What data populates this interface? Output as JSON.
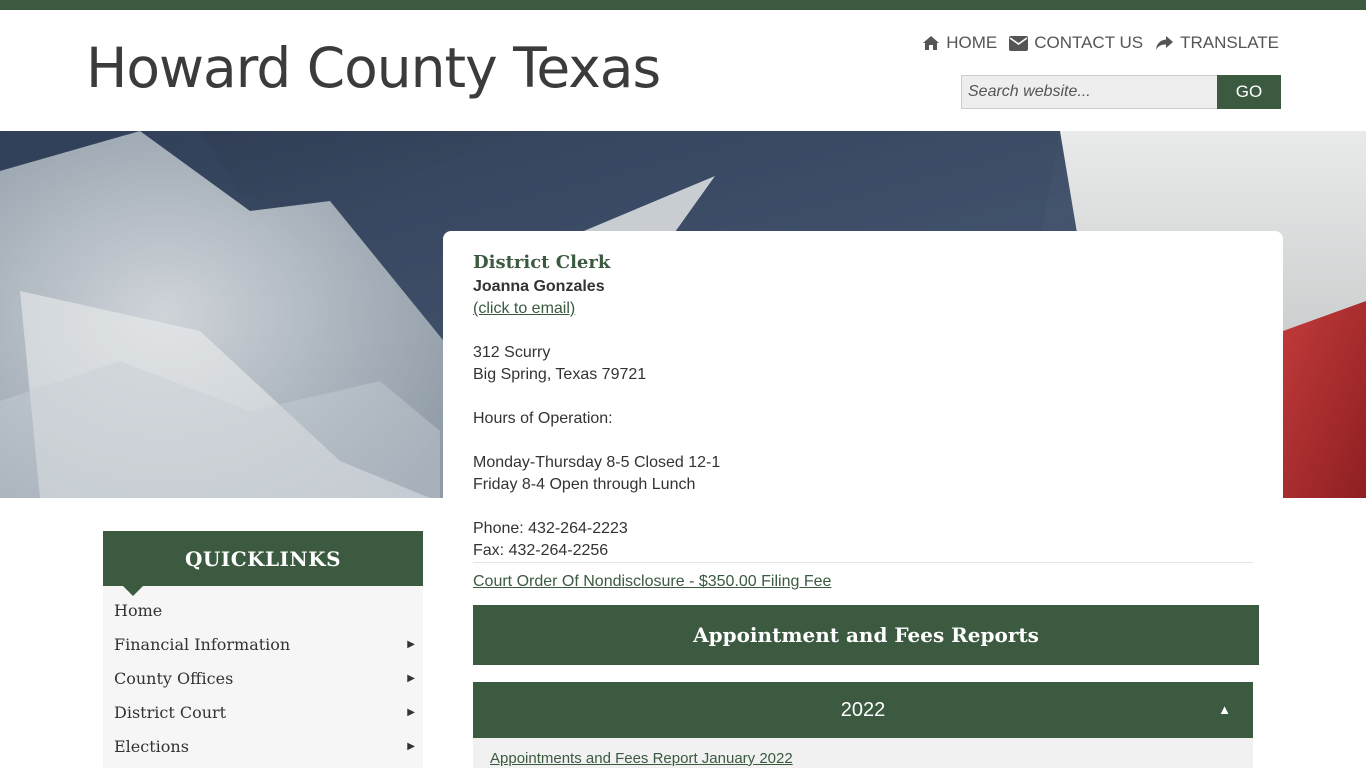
{
  "site": {
    "title": "Howard County Texas"
  },
  "util_nav": {
    "home": "HOME",
    "contact": "CONTACT US",
    "translate": "TRANSLATE"
  },
  "search": {
    "placeholder": "Search website...",
    "button": "GO"
  },
  "content": {
    "title": "District Clerk",
    "name": "Joanna Gonzales",
    "email_link": "(click to email)",
    "address_line1": "312 Scurry",
    "address_line2": "Big Spring, Texas 79721",
    "hours_label": "Hours of Operation:",
    "hours_line1": "Monday-Thursday 8-5 Closed 12-1",
    "hours_line2": "Friday 8-4 Open through Lunch",
    "phone": "Phone: 432-264-2223",
    "fax": "Fax: 432-264-2256",
    "nondisclosure_link": "Court Order Of Nondisclosure - $350.00 Filing Fee",
    "section_heading": "Appointment and Fees Reports",
    "accordion": {
      "year": "2022",
      "caret": "▲",
      "first_link": "Appointments and Fees Report January 2022"
    }
  },
  "quicklinks": {
    "heading": "QUICKLINKS",
    "items": [
      {
        "label": "Home",
        "arrow": ""
      },
      {
        "label": "Financial Information",
        "arrow": "▶"
      },
      {
        "label": "County Offices",
        "arrow": "▶"
      },
      {
        "label": "District Court",
        "arrow": "▶"
      },
      {
        "label": "Elections",
        "arrow": "▶"
      }
    ]
  },
  "colors": {
    "brand_green": "#3b5a40",
    "text": "#333333"
  }
}
